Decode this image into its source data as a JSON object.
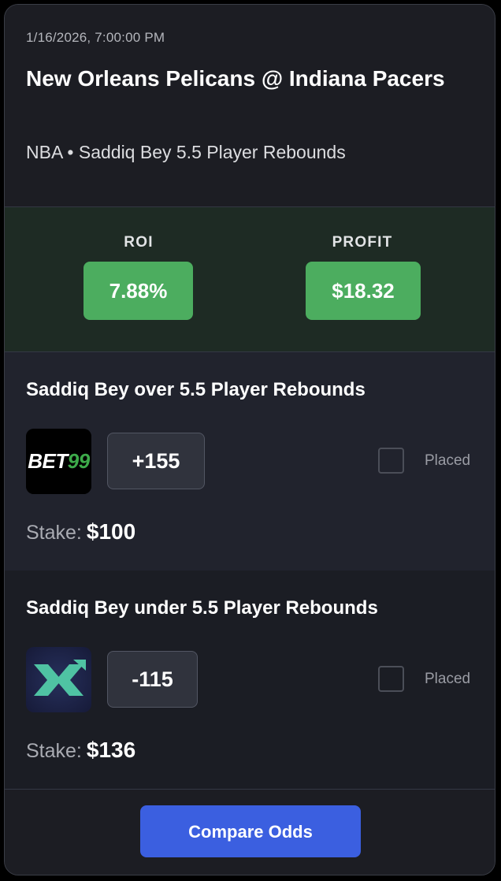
{
  "event": {
    "datetime": "1/16/2026, 7:00:00 PM",
    "title": "New Orleans Pelicans @ Indiana Pacers",
    "subtitle": "NBA • Saddiq Bey 5.5 Player Rebounds"
  },
  "metrics": {
    "roi_label": "ROI",
    "roi_value": "7.88%",
    "profit_label": "PROFIT",
    "profit_value": "$18.32"
  },
  "legs": [
    {
      "title": "Saddiq Bey over 5.5 Player Rebounds",
      "book": "BET99",
      "book_logo_text_a": "BET",
      "book_logo_text_b": "99",
      "odds": "+155",
      "placed_label": "Placed",
      "placed": false,
      "stake_label": "Stake:",
      "stake_value": "$100"
    },
    {
      "title": "Saddiq Bey under 5.5 Player Rebounds",
      "book": "x-sportsbook",
      "odds": "-115",
      "placed_label": "Placed",
      "placed": false,
      "stake_label": "Stake:",
      "stake_value": "$136"
    }
  ],
  "footer": {
    "compare_label": "Compare Odds"
  },
  "colors": {
    "accent_green": "#4cad5f",
    "button_blue": "#3b5fe0",
    "bet99_green": "#3daa4a",
    "x_logo": "#4fc3a3"
  }
}
